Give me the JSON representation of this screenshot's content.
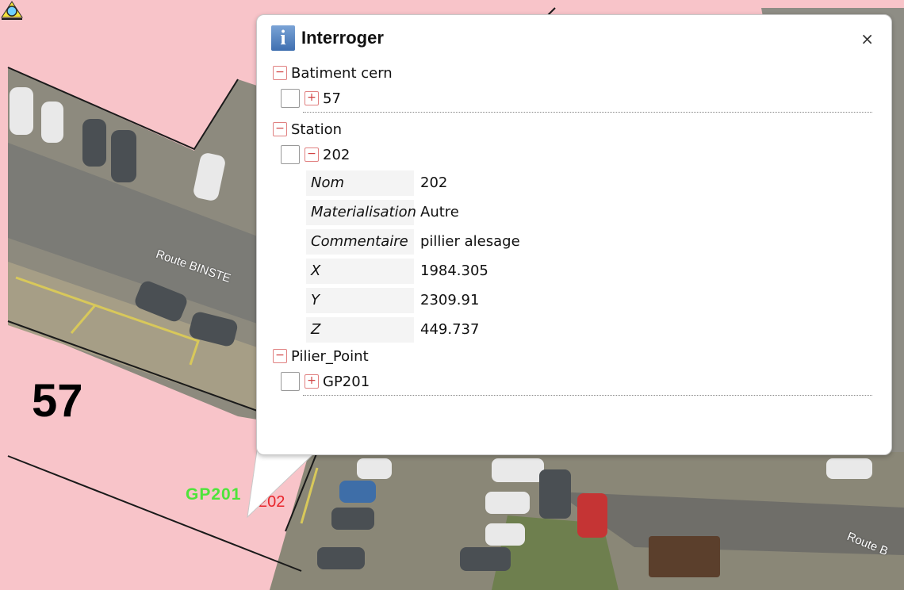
{
  "map": {
    "parcel_number": "57",
    "roads": [
      "Route BINSTE",
      "Route B"
    ],
    "point_label_green": "GP201",
    "point_label_red": "202"
  },
  "popup": {
    "title": "Interroger",
    "icon": "info-icon",
    "close_label": "×",
    "groups": [
      {
        "name": "Batiment cern",
        "items": [
          {
            "label": "57",
            "expanded": false
          }
        ]
      },
      {
        "name": "Station",
        "items": [
          {
            "label": "202",
            "expanded": true,
            "attributes": [
              {
                "key": "Nom",
                "value": "202"
              },
              {
                "key": "Materialisation",
                "value": "Autre"
              },
              {
                "key": "Commentaire",
                "value": "pillier alesage"
              },
              {
                "key": "X",
                "value": "1984.305"
              },
              {
                "key": "Y",
                "value": "2309.91"
              },
              {
                "key": "Z",
                "value": "449.737"
              }
            ]
          }
        ]
      },
      {
        "name": "Pilier_Point",
        "items": [
          {
            "label": "GP201",
            "expanded": false
          }
        ]
      }
    ]
  },
  "colors": {
    "parcel": "#f8c4c9",
    "parcel_line": "#1a1a1a",
    "accent_green": "#4ee43a",
    "accent_red": "#e8242a"
  }
}
